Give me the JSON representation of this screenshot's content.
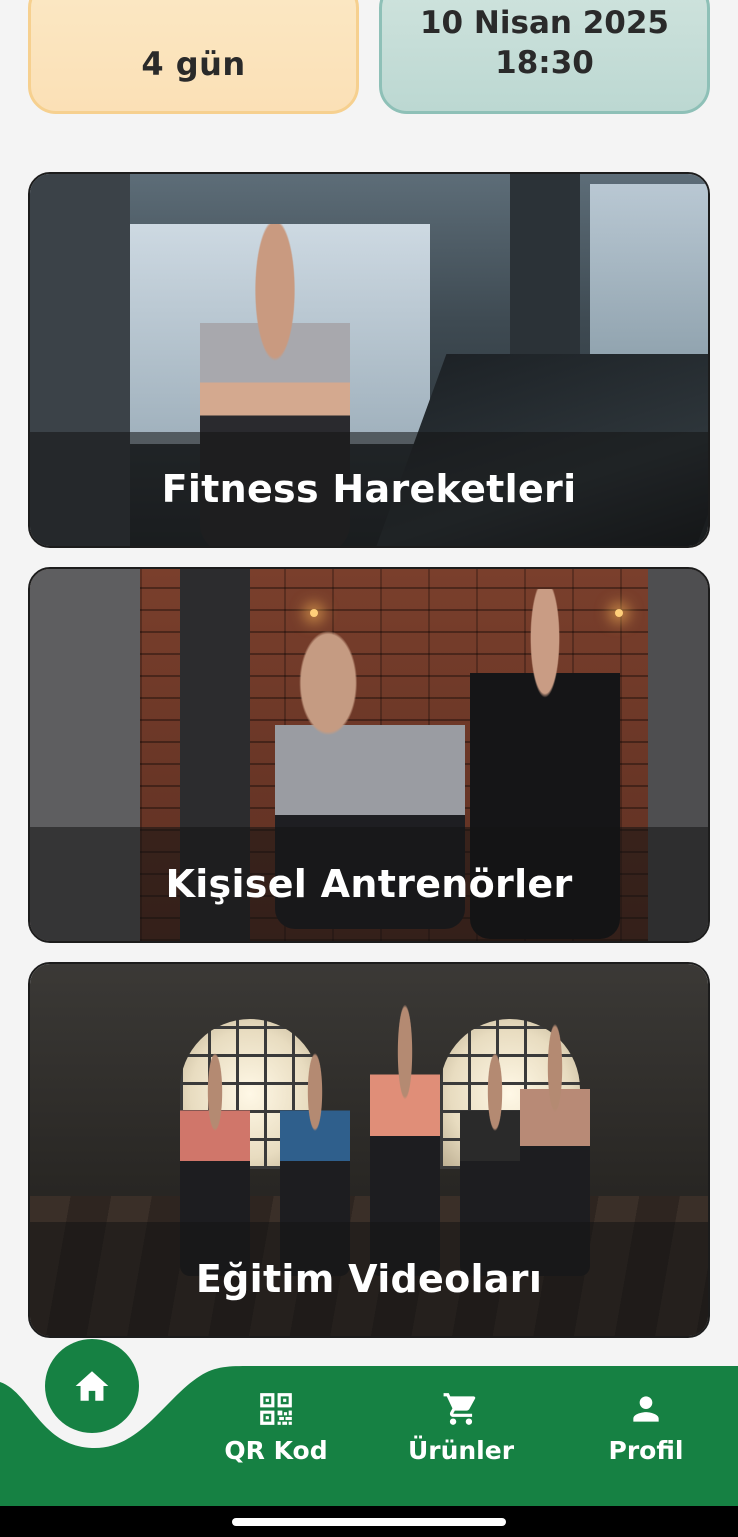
{
  "info_cards": {
    "left": {
      "value": "4 gün"
    },
    "right": {
      "date": "10 Nisan 2025",
      "time": "18:30"
    }
  },
  "tiles": [
    {
      "label": "Fitness Hareketleri"
    },
    {
      "label": "Kişisel Antrenörler"
    },
    {
      "label": "Eğitim Videoları"
    }
  ],
  "nav": {
    "home_icon": "home-icon",
    "items": [
      {
        "label": "QR Kod",
        "icon": "qr-code-icon"
      },
      {
        "label": "Ürünler",
        "icon": "cart-icon"
      },
      {
        "label": "Profil",
        "icon": "person-icon"
      }
    ]
  },
  "colors": {
    "brand_green": "#168143",
    "card_left_bg": "#fbe4bd",
    "card_right_bg": "#c6ddd7"
  }
}
